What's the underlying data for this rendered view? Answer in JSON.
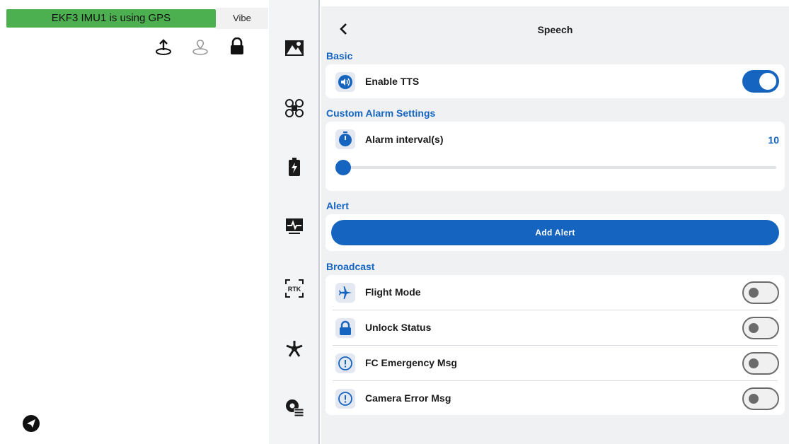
{
  "status": {
    "banner_text": "EKF3 IMU1 is using GPS",
    "vibe_label": "Vibe",
    "banner_color": "#4caf50"
  },
  "top_icons": [
    "upload-icon",
    "location-pin-icon",
    "lock-icon"
  ],
  "rail": {
    "items": [
      "map-icon",
      "drone-icon",
      "battery-icon",
      "monitor-icon",
      "rtk-icon",
      "swarm-icon",
      "settings-list-icon"
    ],
    "rtk_text": "RTK"
  },
  "panel": {
    "title": "Speech",
    "sections": {
      "basic": "Basic",
      "custom": "Custom Alarm Settings",
      "alert": "Alert",
      "broadcast": "Broadcast"
    },
    "enable_tts": {
      "label": "Enable TTS",
      "on": true
    },
    "alarm_interval": {
      "label": "Alarm interval(s)",
      "value": "10",
      "slider_fraction": 0.0
    },
    "add_alert_label": "Add Alert",
    "broadcast_items": [
      {
        "label": "Flight Mode",
        "icon": "airplane-icon",
        "on": false
      },
      {
        "label": "Unlock Status",
        "icon": "lock-icon",
        "on": false
      },
      {
        "label": "FC Emergency Msg",
        "icon": "alert-circle-icon",
        "on": false
      },
      {
        "label": "Camera Error Msg",
        "icon": "alert-circle-icon",
        "on": false
      }
    ]
  },
  "colors": {
    "accent": "#1565c0",
    "panel_bg": "#f0f1f3",
    "rail_bg": "#f3f4f6"
  }
}
